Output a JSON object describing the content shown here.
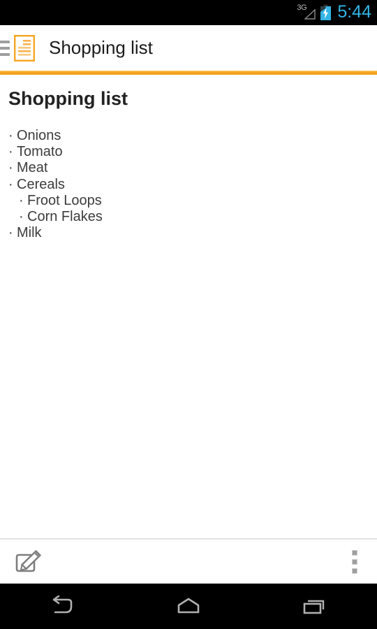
{
  "status_bar": {
    "network_label": "3G",
    "signal_icon": "signal-triangle-icon",
    "battery_icon": "battery-charging-icon",
    "clock": "5:44",
    "accent_color": "#33b5e5",
    "background": "#000000"
  },
  "app_bar": {
    "drawer_icon": "hamburger-menu-icon",
    "note_icon": "note-document-icon",
    "title": "Shopping list",
    "accent_color": "#f5a623"
  },
  "content": {
    "title": "Shopping list",
    "items": [
      {
        "bullet": "·",
        "text": "Onions",
        "level": 0
      },
      {
        "bullet": "·",
        "text": "Tomato",
        "level": 0
      },
      {
        "bullet": "·",
        "text": "Meat",
        "level": 0
      },
      {
        "bullet": "·",
        "text": "Cereals",
        "level": 0
      },
      {
        "bullet": "·",
        "text": "Froot Loops",
        "level": 1
      },
      {
        "bullet": "·",
        "text": "Corn Flakes",
        "level": 1
      },
      {
        "bullet": "·",
        "text": "Milk",
        "level": 0
      }
    ]
  },
  "bottom_bar": {
    "edit_icon": "edit-pencil-icon",
    "overflow_icon": "overflow-menu-icon"
  },
  "nav_bar": {
    "back_icon": "back-arrow-icon",
    "home_icon": "home-icon",
    "recents_icon": "recent-apps-icon"
  }
}
